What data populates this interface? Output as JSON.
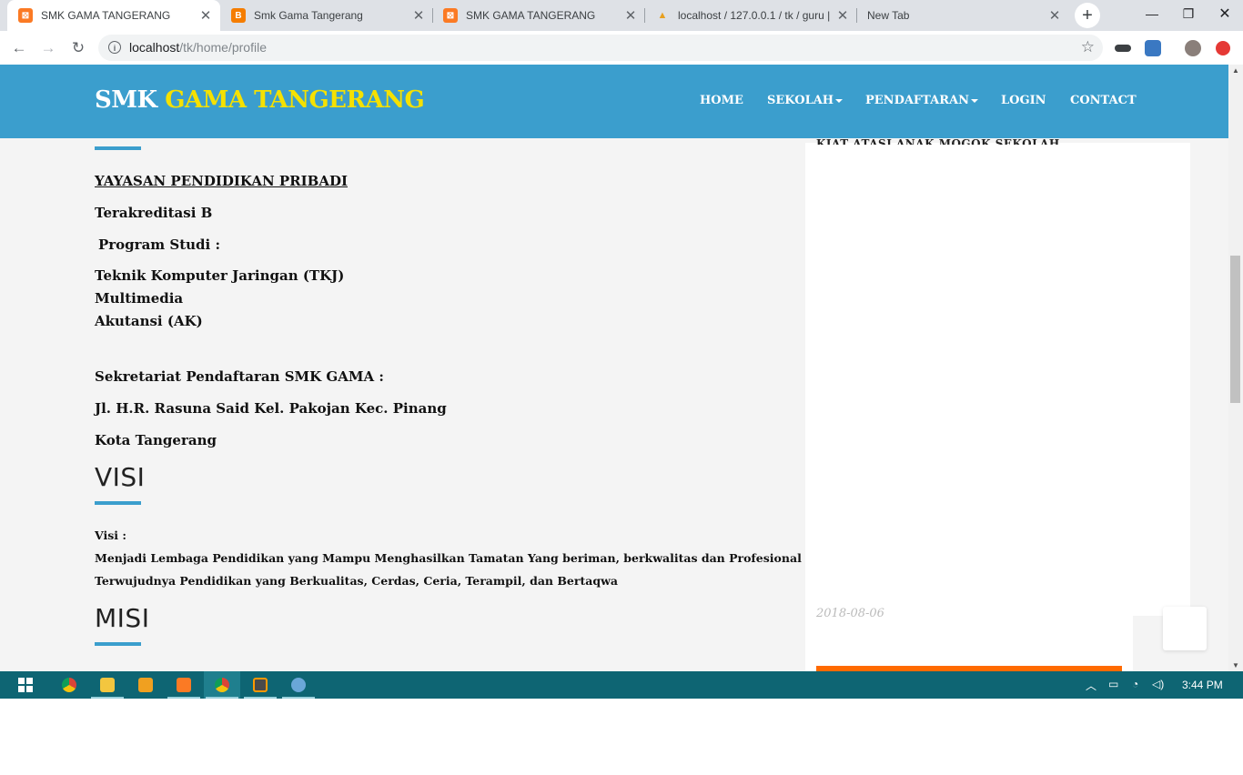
{
  "browser": {
    "tabs": [
      {
        "label": "SMK GAMA TANGERANG",
        "icon": "xampp-icon",
        "active": true
      },
      {
        "label": "Smk Gama Tangerang",
        "icon": "blogger-icon",
        "active": false
      },
      {
        "label": "SMK GAMA TANGERANG",
        "icon": "xampp-icon",
        "active": false
      },
      {
        "label": "localhost / 127.0.0.1 / tk / guru |",
        "icon": "phpmyadmin-icon",
        "active": false
      },
      {
        "label": "New Tab",
        "icon": "",
        "active": false
      }
    ],
    "url_host": "localhost",
    "url_path": "/tk/home/profile",
    "colors": {
      "tab_bg": "#dee1e6",
      "omnibox_bg": "#f1f3f4"
    }
  },
  "site": {
    "brand_white": "SMK",
    "brand_yellow": "GAMA TANGERANG",
    "menu": [
      {
        "label": "HOME",
        "dropdown": false
      },
      {
        "label": "SEKOLAH",
        "dropdown": true
      },
      {
        "label": "PENDAFTARAN",
        "dropdown": true
      },
      {
        "label": "LOGIN",
        "dropdown": false
      },
      {
        "label": "CONTACT",
        "dropdown": false
      }
    ],
    "colors": {
      "navbar": "#3b9ecd",
      "brand_highlight": "#f5e100",
      "accent_bar": "#3b9ecd",
      "cta": "#ff6a00"
    }
  },
  "content": {
    "yayasan": "YAYASAN PENDIDIKAN PRIBADI",
    "akreditasi": "Terakreditasi B",
    "program_heading": "Program Studi :",
    "programs": [
      "Teknik Komputer Jaringan (TKJ)",
      "Multimedia",
      "Akutansi (AK)"
    ],
    "sekretariat": "Sekretariat Pendaftaran SMK GAMA :",
    "alamat": "Jl. H.R. Rasuna Said Kel. Pakojan Kec. Pinang",
    "kota": "Kota Tangerang",
    "visi_heading": "VISI",
    "visi_label": "Visi :",
    "visi_lines": [
      "Menjadi Lembaga Pendidikan yang Mampu Menghasilkan Tamatan Yang beriman, berkwalitas dan Profesional",
      "Terwujudnya Pendidikan yang Berkualitas, Cerdas, Ceria, Terampil, dan Bertaqwa"
    ],
    "misi_heading": "MISI"
  },
  "sidebar": {
    "clipped_title": "KIAT ATASI ANAK MOGOK SEKOLAH",
    "date": "2018-08-06"
  },
  "taskbar": {
    "apps": [
      "windows-start-icon",
      "chrome-icon",
      "file-explorer-icon",
      "media-player-icon",
      "xampp-icon",
      "chrome-icon",
      "sublime-text-icon",
      "paint-icon"
    ],
    "clock": "3:44 PM"
  }
}
